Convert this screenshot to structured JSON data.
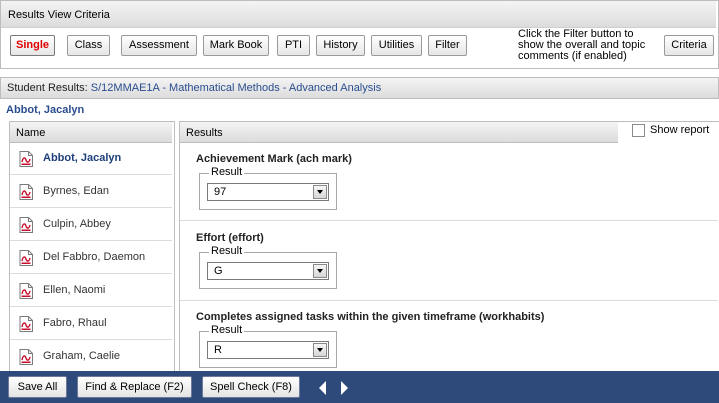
{
  "criteria_panel": {
    "title": "Results View Criteria",
    "buttons": [
      "Single",
      "Class",
      "Assessment",
      "Mark Book",
      "PTI",
      "History",
      "Utilities",
      "Filter"
    ],
    "hint": [
      "Click the Filter button to",
      "show the overall and topic",
      "comments (if enabled)"
    ],
    "criteria_button": "Criteria"
  },
  "results_header": {
    "prefix": "Student Results:",
    "class_link": "S/12MMAE1A - Mathematical Methods - Advanced Analysis"
  },
  "selected_student": "Abbot, Jacalyn",
  "student_list": {
    "header": "Name",
    "students": [
      "Abbot, Jacalyn",
      "Byrnes, Edan",
      "Culpin, Abbey",
      "Del Fabbro, Daemon",
      "Ellen, Naomi",
      "Fabro, Rhaul",
      "Graham, Caelie"
    ]
  },
  "results_panel": {
    "header": "Results",
    "show_report_label": "Show report",
    "sections": [
      {
        "title": "Achievement Mark  (ach mark)",
        "result_label": "Result",
        "value": "97"
      },
      {
        "title": "Effort  (effort)",
        "result_label": "Result",
        "value": "G"
      },
      {
        "title": "Completes assigned tasks within the given timeframe  (workhabits)",
        "result_label": "Result",
        "value": "R"
      }
    ]
  },
  "footer": {
    "save_all": "Save All",
    "find_replace": "Find & Replace (F2)",
    "spell_check": "Spell Check (F8)"
  },
  "colors": {
    "footer_bg": "#2d4a7a",
    "link": "#2a4d8f",
    "active_button": "#e00000"
  }
}
